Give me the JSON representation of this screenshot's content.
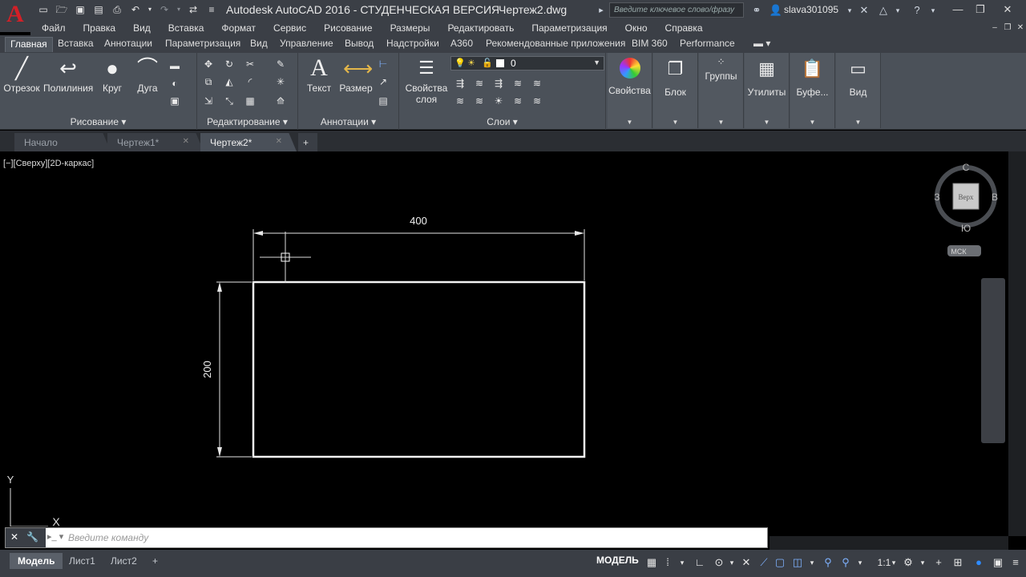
{
  "window": {
    "app_title": "Autodesk AutoCAD 2016 - СТУДЕНЧЕСКАЯ ВЕРСИЯ",
    "doc_title": "Чертеж2.dwg",
    "search_placeholder": "Введите ключевое слово/фразу",
    "username": "slava301095"
  },
  "menu": [
    "Файл",
    "Правка",
    "Вид",
    "Вставка",
    "Формат",
    "Сервис",
    "Рисование",
    "Размеры",
    "Редактировать",
    "Параметризация",
    "Окно",
    "Справка"
  ],
  "ribbon_tabs": [
    "Главная",
    "Вставка",
    "Аннотации",
    "Параметризация",
    "Вид",
    "Управление",
    "Вывод",
    "Надстройки",
    "A360",
    "Рекомендованные приложения",
    "BIM 360",
    "Performance"
  ],
  "ribbon": {
    "draw": {
      "title": "Рисование",
      "line": "Отрезок",
      "polyline": "Полилиния",
      "circle": "Круг",
      "arc": "Дуга"
    },
    "modify": {
      "title": "Редактирование"
    },
    "annotation": {
      "title": "Аннотации",
      "text": "Текст",
      "dimension": "Размер"
    },
    "layers": {
      "title": "Слои",
      "properties_line1": "Свойства",
      "properties_line2": "слоя",
      "current_layer": "0"
    },
    "properties": "Свойства",
    "block": "Блок",
    "groups": "Группы",
    "utilities": "Утилиты",
    "clipboard": "Буфе...",
    "view": "Вид"
  },
  "file_tabs": [
    "Начало",
    "Чертеж1*",
    "Чертеж2*"
  ],
  "viewport_label": "[−][Сверху][2D-каркас]",
  "viewcube": {
    "face": "Верх",
    "north": "С",
    "south": "Ю",
    "west": "З",
    "east": "В",
    "ucs": "МСК"
  },
  "drawing": {
    "dim_horizontal": "400",
    "dim_vertical": "200",
    "ucs_x": "X",
    "ucs_y": "Y"
  },
  "command_line": {
    "placeholder": "Введите команду"
  },
  "layout_tabs": [
    "Модель",
    "Лист1",
    "Лист2"
  ],
  "status": {
    "model": "МОДЕЛЬ",
    "scale": "1:1"
  }
}
